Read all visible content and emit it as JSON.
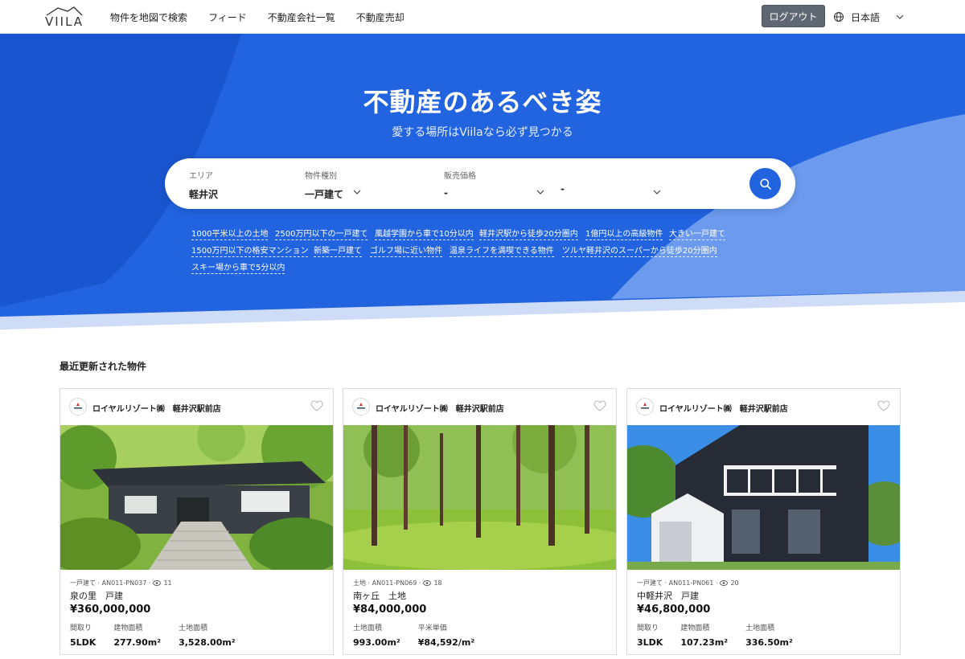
{
  "header": {
    "logo_text": "VIILA",
    "nav": [
      "物件を地図で検索",
      "フィード",
      "不動産会社一覧",
      "不動産売却"
    ],
    "logout_label": "ログアウト",
    "language": "日本語"
  },
  "hero": {
    "title": "不動産のあるべき姿",
    "subtitle": "愛する場所はViilaなら必ず見つかる",
    "colors": {
      "primary": "#2263e0",
      "dark": "#1a4fc9",
      "light": "#6c9aee",
      "lighter": "#cfdcf8"
    }
  },
  "search": {
    "area_label": "エリア",
    "area_value": "軽井沢",
    "type_label": "物件種別",
    "type_value": "一戸建て",
    "price_label": "販売価格",
    "price_min": "-",
    "price_max": "-"
  },
  "tags": [
    "1000平米以上の土地",
    "2500万円以下の一戸建て",
    "風越学園から車で10分以内",
    "軽井沢駅から徒歩20分圏内",
    "1億円以上の高級物件",
    "大きい一戸建て",
    "1500万円以下の格安マンション",
    "新築一戸建て",
    "ゴルフ場に近い物件",
    "温泉ライフを満喫できる物件",
    "ツルヤ軽井沢のスーパーから徒歩20分圏内",
    "スキー場から車で5分以内"
  ],
  "section": {
    "title": "最近更新された物件"
  },
  "listings": [
    {
      "company": "ロイヤルリゾート㈱",
      "branch": "軽井沢駅前店",
      "category": "一戸建て",
      "code": "AN011-PN037",
      "views": "11",
      "name": "泉の里　戸建",
      "price": "¥360,000,000",
      "specs": [
        {
          "label": "間取り",
          "value": "5LDK"
        },
        {
          "label": "建物面積",
          "value": "277.90m²"
        },
        {
          "label": "土地面積",
          "value": "3,528.00m²"
        }
      ]
    },
    {
      "company": "ロイヤルリゾート㈱",
      "branch": "軽井沢駅前店",
      "category": "土地",
      "code": "AN011-PN069",
      "views": "18",
      "name": "南ヶ丘　土地",
      "price": "¥84,000,000",
      "specs": [
        {
          "label": "土地面積",
          "value": "993.00m²"
        },
        {
          "label": "平米単価",
          "value": "¥84,592/m²"
        }
      ]
    },
    {
      "company": "ロイヤルリゾート㈱",
      "branch": "軽井沢駅前店",
      "category": "一戸建て",
      "code": "AN011-PN061",
      "views": "20",
      "name": "中軽井沢　戸建",
      "price": "¥46,800,000",
      "specs": [
        {
          "label": "間取り",
          "value": "3LDK"
        },
        {
          "label": "建物面積",
          "value": "107.23m²"
        },
        {
          "label": "土地面積",
          "value": "336.50m²"
        }
      ]
    }
  ]
}
